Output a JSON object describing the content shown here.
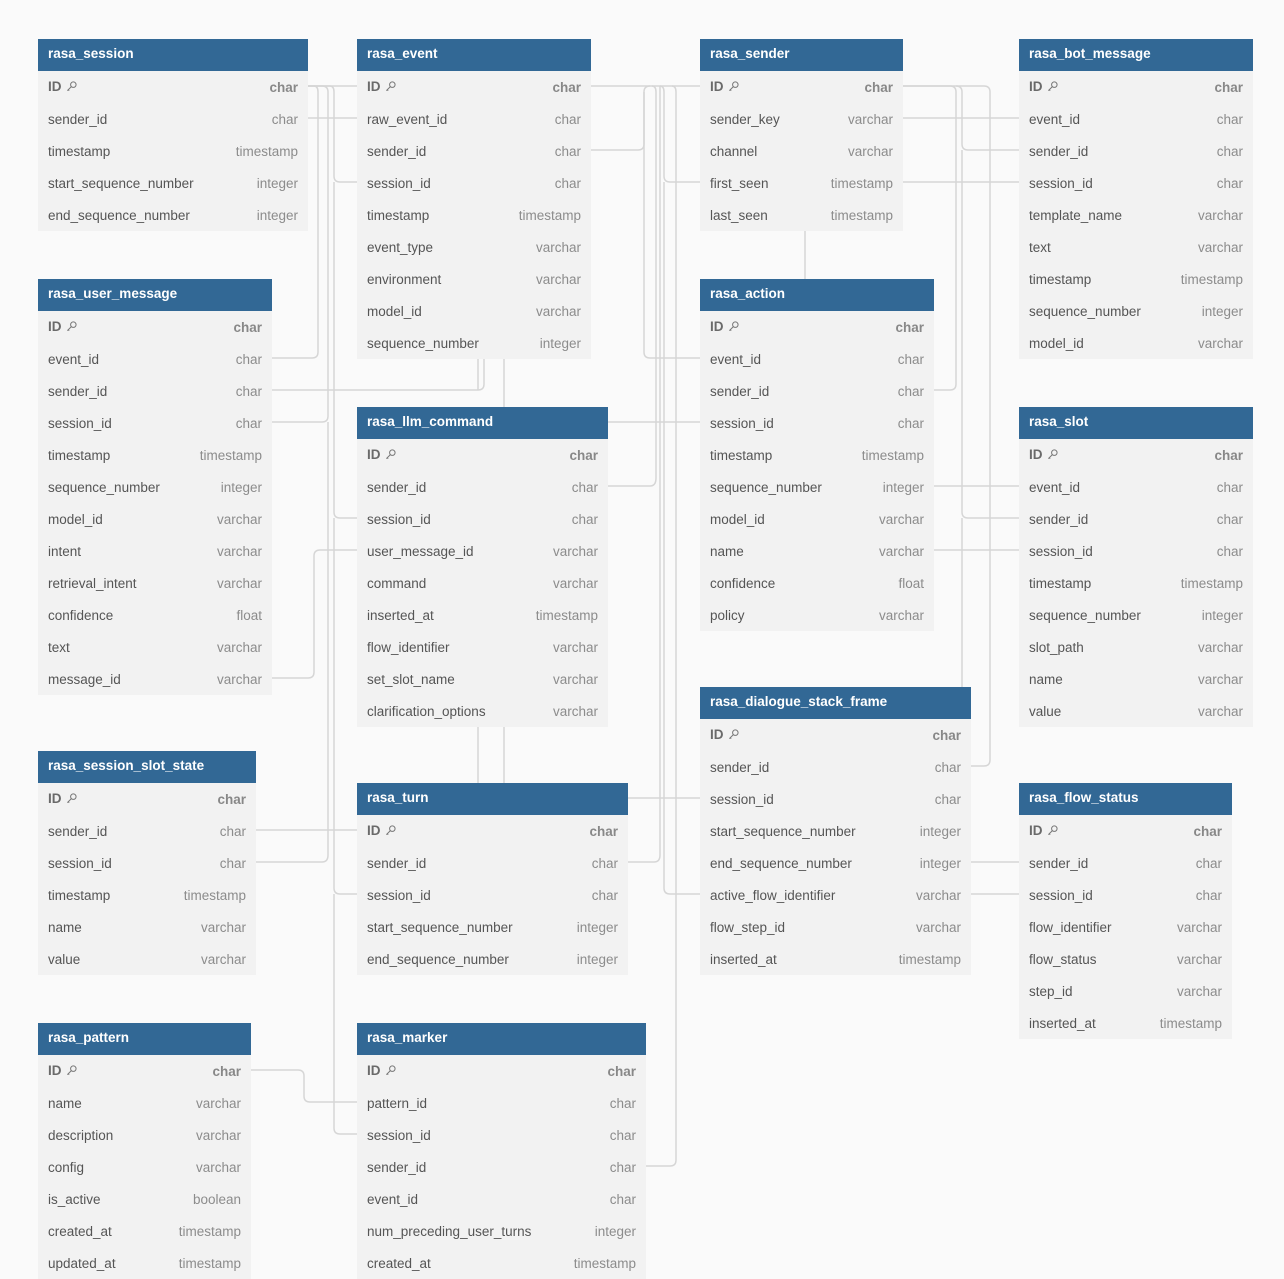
{
  "diagram": {
    "colors": {
      "header": "#326895",
      "body": "#f2f2f2",
      "line": "#d6d6d6",
      "canvas": "#fafafa"
    },
    "pk_icon": "key-icon",
    "tables": [
      {
        "id": "rasa_session",
        "name": "rasa_session",
        "columns": [
          {
            "name": "ID",
            "type": "char",
            "pk": true
          },
          {
            "name": "sender_id",
            "type": "char"
          },
          {
            "name": "timestamp",
            "type": "timestamp"
          },
          {
            "name": "start_sequence_number",
            "type": "integer"
          },
          {
            "name": "end_sequence_number",
            "type": "integer"
          }
        ]
      },
      {
        "id": "rasa_event",
        "name": "rasa_event",
        "columns": [
          {
            "name": "ID",
            "type": "char",
            "pk": true
          },
          {
            "name": "raw_event_id",
            "type": "char"
          },
          {
            "name": "sender_id",
            "type": "char"
          },
          {
            "name": "session_id",
            "type": "char"
          },
          {
            "name": "timestamp",
            "type": "timestamp"
          },
          {
            "name": "event_type",
            "type": "varchar"
          },
          {
            "name": "environment",
            "type": "varchar"
          },
          {
            "name": "model_id",
            "type": "varchar"
          },
          {
            "name": "sequence_number",
            "type": "integer"
          }
        ]
      },
      {
        "id": "rasa_sender",
        "name": "rasa_sender",
        "columns": [
          {
            "name": "ID",
            "type": "char",
            "pk": true
          },
          {
            "name": "sender_key",
            "type": "varchar"
          },
          {
            "name": "channel",
            "type": "varchar"
          },
          {
            "name": "first_seen",
            "type": "timestamp"
          },
          {
            "name": "last_seen",
            "type": "timestamp"
          }
        ]
      },
      {
        "id": "rasa_bot_message",
        "name": "rasa_bot_message",
        "columns": [
          {
            "name": "ID",
            "type": "char",
            "pk": true
          },
          {
            "name": "event_id",
            "type": "char"
          },
          {
            "name": "sender_id",
            "type": "char"
          },
          {
            "name": "session_id",
            "type": "char"
          },
          {
            "name": "template_name",
            "type": "varchar"
          },
          {
            "name": "text",
            "type": "varchar"
          },
          {
            "name": "timestamp",
            "type": "timestamp"
          },
          {
            "name": "sequence_number",
            "type": "integer"
          },
          {
            "name": "model_id",
            "type": "varchar"
          }
        ]
      },
      {
        "id": "rasa_user_message",
        "name": "rasa_user_message",
        "columns": [
          {
            "name": "ID",
            "type": "char",
            "pk": true
          },
          {
            "name": "event_id",
            "type": "char"
          },
          {
            "name": "sender_id",
            "type": "char"
          },
          {
            "name": "session_id",
            "type": "char"
          },
          {
            "name": "timestamp",
            "type": "timestamp"
          },
          {
            "name": "sequence_number",
            "type": "integer"
          },
          {
            "name": "model_id",
            "type": "varchar"
          },
          {
            "name": "intent",
            "type": "varchar"
          },
          {
            "name": "retrieval_intent",
            "type": "varchar"
          },
          {
            "name": "confidence",
            "type": "float"
          },
          {
            "name": "text",
            "type": "varchar"
          },
          {
            "name": "message_id",
            "type": "varchar"
          }
        ]
      },
      {
        "id": "rasa_llm_command",
        "name": "rasa_llm_command",
        "columns": [
          {
            "name": "ID",
            "type": "char",
            "pk": true
          },
          {
            "name": "sender_id",
            "type": "char"
          },
          {
            "name": "session_id",
            "type": "char"
          },
          {
            "name": "user_message_id",
            "type": "varchar"
          },
          {
            "name": "command",
            "type": "varchar"
          },
          {
            "name": "inserted_at",
            "type": "timestamp"
          },
          {
            "name": "flow_identifier",
            "type": "varchar"
          },
          {
            "name": "set_slot_name",
            "type": "varchar"
          },
          {
            "name": "clarification_options",
            "type": "varchar"
          }
        ]
      },
      {
        "id": "rasa_action",
        "name": "rasa_action",
        "columns": [
          {
            "name": "ID",
            "type": "char",
            "pk": true
          },
          {
            "name": "event_id",
            "type": "char"
          },
          {
            "name": "sender_id",
            "type": "char"
          },
          {
            "name": "session_id",
            "type": "char"
          },
          {
            "name": "timestamp",
            "type": "timestamp"
          },
          {
            "name": "sequence_number",
            "type": "integer"
          },
          {
            "name": "model_id",
            "type": "varchar"
          },
          {
            "name": "name",
            "type": "varchar"
          },
          {
            "name": "confidence",
            "type": "float"
          },
          {
            "name": "policy",
            "type": "varchar"
          }
        ]
      },
      {
        "id": "rasa_slot",
        "name": "rasa_slot",
        "columns": [
          {
            "name": "ID",
            "type": "char",
            "pk": true
          },
          {
            "name": "event_id",
            "type": "char"
          },
          {
            "name": "sender_id",
            "type": "char"
          },
          {
            "name": "session_id",
            "type": "char"
          },
          {
            "name": "timestamp",
            "type": "timestamp"
          },
          {
            "name": "sequence_number",
            "type": "integer"
          },
          {
            "name": "slot_path",
            "type": "varchar"
          },
          {
            "name": "name",
            "type": "varchar"
          },
          {
            "name": "value",
            "type": "varchar"
          }
        ]
      },
      {
        "id": "rasa_dialogue_stack_frame",
        "name": "rasa_dialogue_stack_frame",
        "columns": [
          {
            "name": "ID",
            "type": "char",
            "pk": true
          },
          {
            "name": "sender_id",
            "type": "char"
          },
          {
            "name": "session_id",
            "type": "char"
          },
          {
            "name": "start_sequence_number",
            "type": "integer"
          },
          {
            "name": "end_sequence_number",
            "type": "integer"
          },
          {
            "name": "active_flow_identifier",
            "type": "varchar"
          },
          {
            "name": "flow_step_id",
            "type": "varchar"
          },
          {
            "name": "inserted_at",
            "type": "timestamp"
          }
        ]
      },
      {
        "id": "rasa_session_slot_state",
        "name": "rasa_session_slot_state",
        "columns": [
          {
            "name": "ID",
            "type": "char",
            "pk": true
          },
          {
            "name": "sender_id",
            "type": "char"
          },
          {
            "name": "session_id",
            "type": "char"
          },
          {
            "name": "timestamp",
            "type": "timestamp"
          },
          {
            "name": "name",
            "type": "varchar"
          },
          {
            "name": "value",
            "type": "varchar"
          }
        ]
      },
      {
        "id": "rasa_turn",
        "name": "rasa_turn",
        "columns": [
          {
            "name": "ID",
            "type": "char",
            "pk": true
          },
          {
            "name": "sender_id",
            "type": "char"
          },
          {
            "name": "session_id",
            "type": "char"
          },
          {
            "name": "start_sequence_number",
            "type": "integer"
          },
          {
            "name": "end_sequence_number",
            "type": "integer"
          }
        ]
      },
      {
        "id": "rasa_flow_status",
        "name": "rasa_flow_status",
        "columns": [
          {
            "name": "ID",
            "type": "char",
            "pk": true
          },
          {
            "name": "sender_id",
            "type": "char"
          },
          {
            "name": "session_id",
            "type": "char"
          },
          {
            "name": "flow_identifier",
            "type": "varchar"
          },
          {
            "name": "flow_status",
            "type": "varchar"
          },
          {
            "name": "step_id",
            "type": "varchar"
          },
          {
            "name": "inserted_at",
            "type": "timestamp"
          }
        ]
      },
      {
        "id": "rasa_pattern",
        "name": "rasa_pattern",
        "columns": [
          {
            "name": "ID",
            "type": "char",
            "pk": true
          },
          {
            "name": "name",
            "type": "varchar"
          },
          {
            "name": "description",
            "type": "varchar"
          },
          {
            "name": "config",
            "type": "varchar"
          },
          {
            "name": "is_active",
            "type": "boolean"
          },
          {
            "name": "created_at",
            "type": "timestamp"
          },
          {
            "name": "updated_at",
            "type": "timestamp"
          }
        ]
      },
      {
        "id": "rasa_marker",
        "name": "rasa_marker",
        "columns": [
          {
            "name": "ID",
            "type": "char",
            "pk": true
          },
          {
            "name": "pattern_id",
            "type": "char"
          },
          {
            "name": "session_id",
            "type": "char"
          },
          {
            "name": "sender_id",
            "type": "char"
          },
          {
            "name": "event_id",
            "type": "char"
          },
          {
            "name": "num_preceding_user_turns",
            "type": "integer"
          },
          {
            "name": "created_at",
            "type": "timestamp"
          }
        ]
      }
    ]
  }
}
